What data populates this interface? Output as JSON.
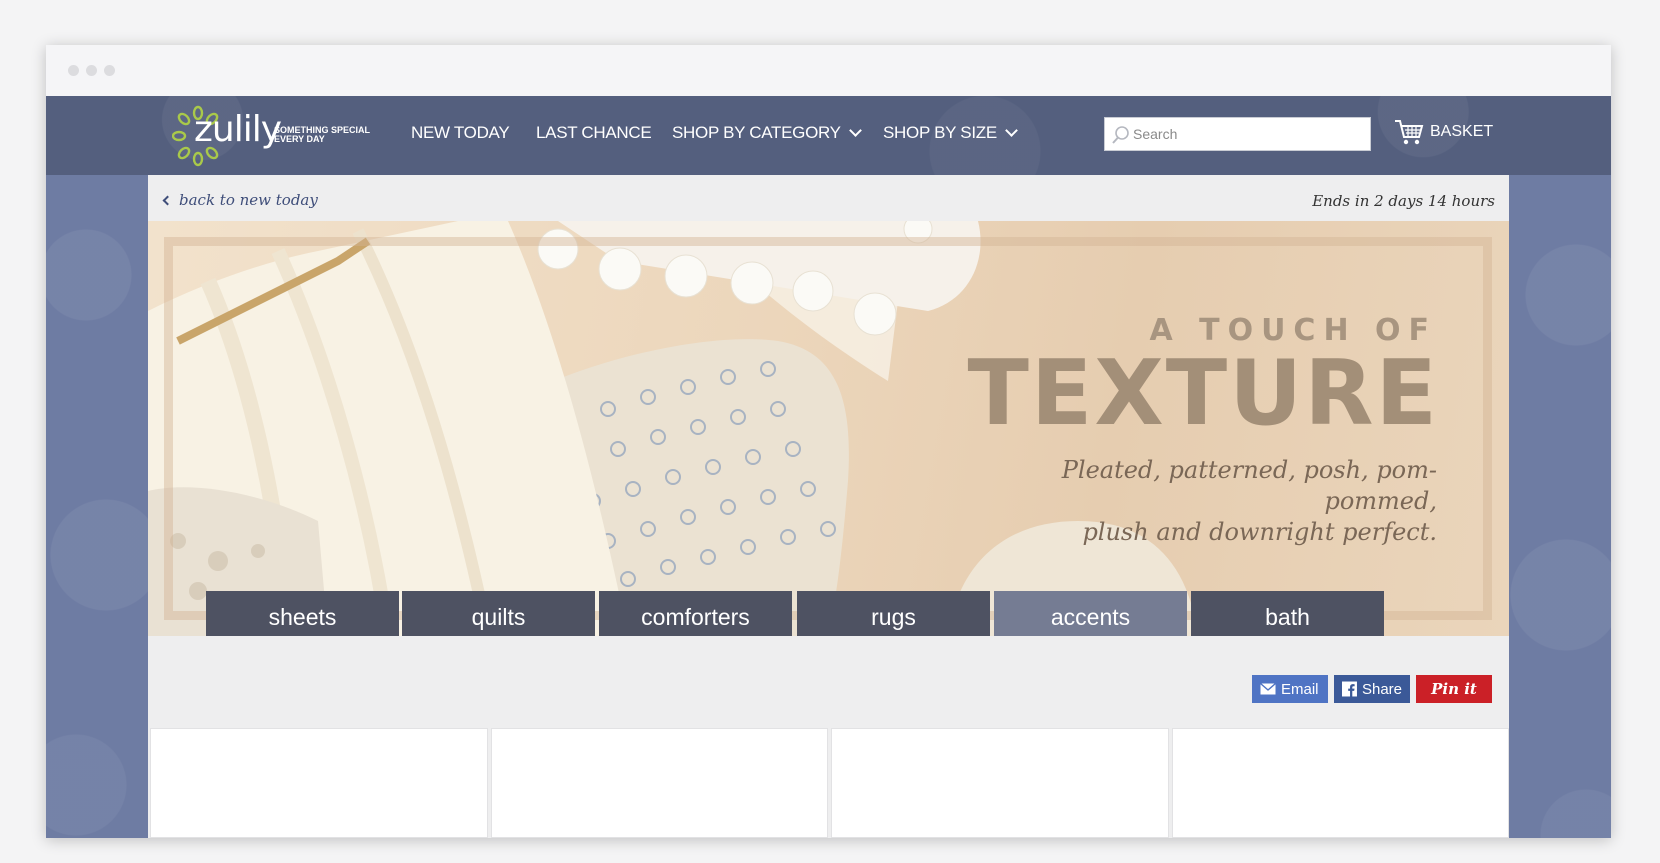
{
  "browser": {
    "dots": [
      "close",
      "minimize",
      "zoom"
    ]
  },
  "header": {
    "logo_word": "zulily",
    "logo_tagline": "SOMETHING SPECIAL EVERY DAY",
    "nav": [
      {
        "label": "NEW TODAY",
        "icon": null
      },
      {
        "label": "LAST CHANCE",
        "icon": null
      },
      {
        "label": "SHOP BY CATEGORY",
        "icon": "chevron-down-icon"
      },
      {
        "label": "SHOP BY SIZE",
        "icon": "chevron-down-icon"
      }
    ],
    "search": {
      "placeholder": "Search",
      "value": "",
      "icon": "search-icon"
    },
    "basket": {
      "label": "BASKET",
      "icon": "cart-icon"
    }
  },
  "event": {
    "back_link": "back to new today",
    "ends": "Ends in 2 days 14 hours"
  },
  "hero": {
    "kicker": "A TOUCH OF",
    "title": "TEXTURE",
    "subtitle_line1": "Pleated, patterned, posh, pom-pommed,",
    "subtitle_line2": "plush and downright perfect.",
    "categories": [
      "sheets",
      "quilts",
      "comforters",
      "rugs",
      "accents",
      "bath"
    ],
    "highlighted_category": "accents"
  },
  "share": {
    "email": "Email",
    "facebook": "Share",
    "pinterest": "Pin it"
  },
  "colors": {
    "navbar": "#545f7e",
    "page_bg": "#6e7ca3",
    "category_button": "#4e5262",
    "category_button_active": "#757c93",
    "hero_text": "#a38f78"
  }
}
